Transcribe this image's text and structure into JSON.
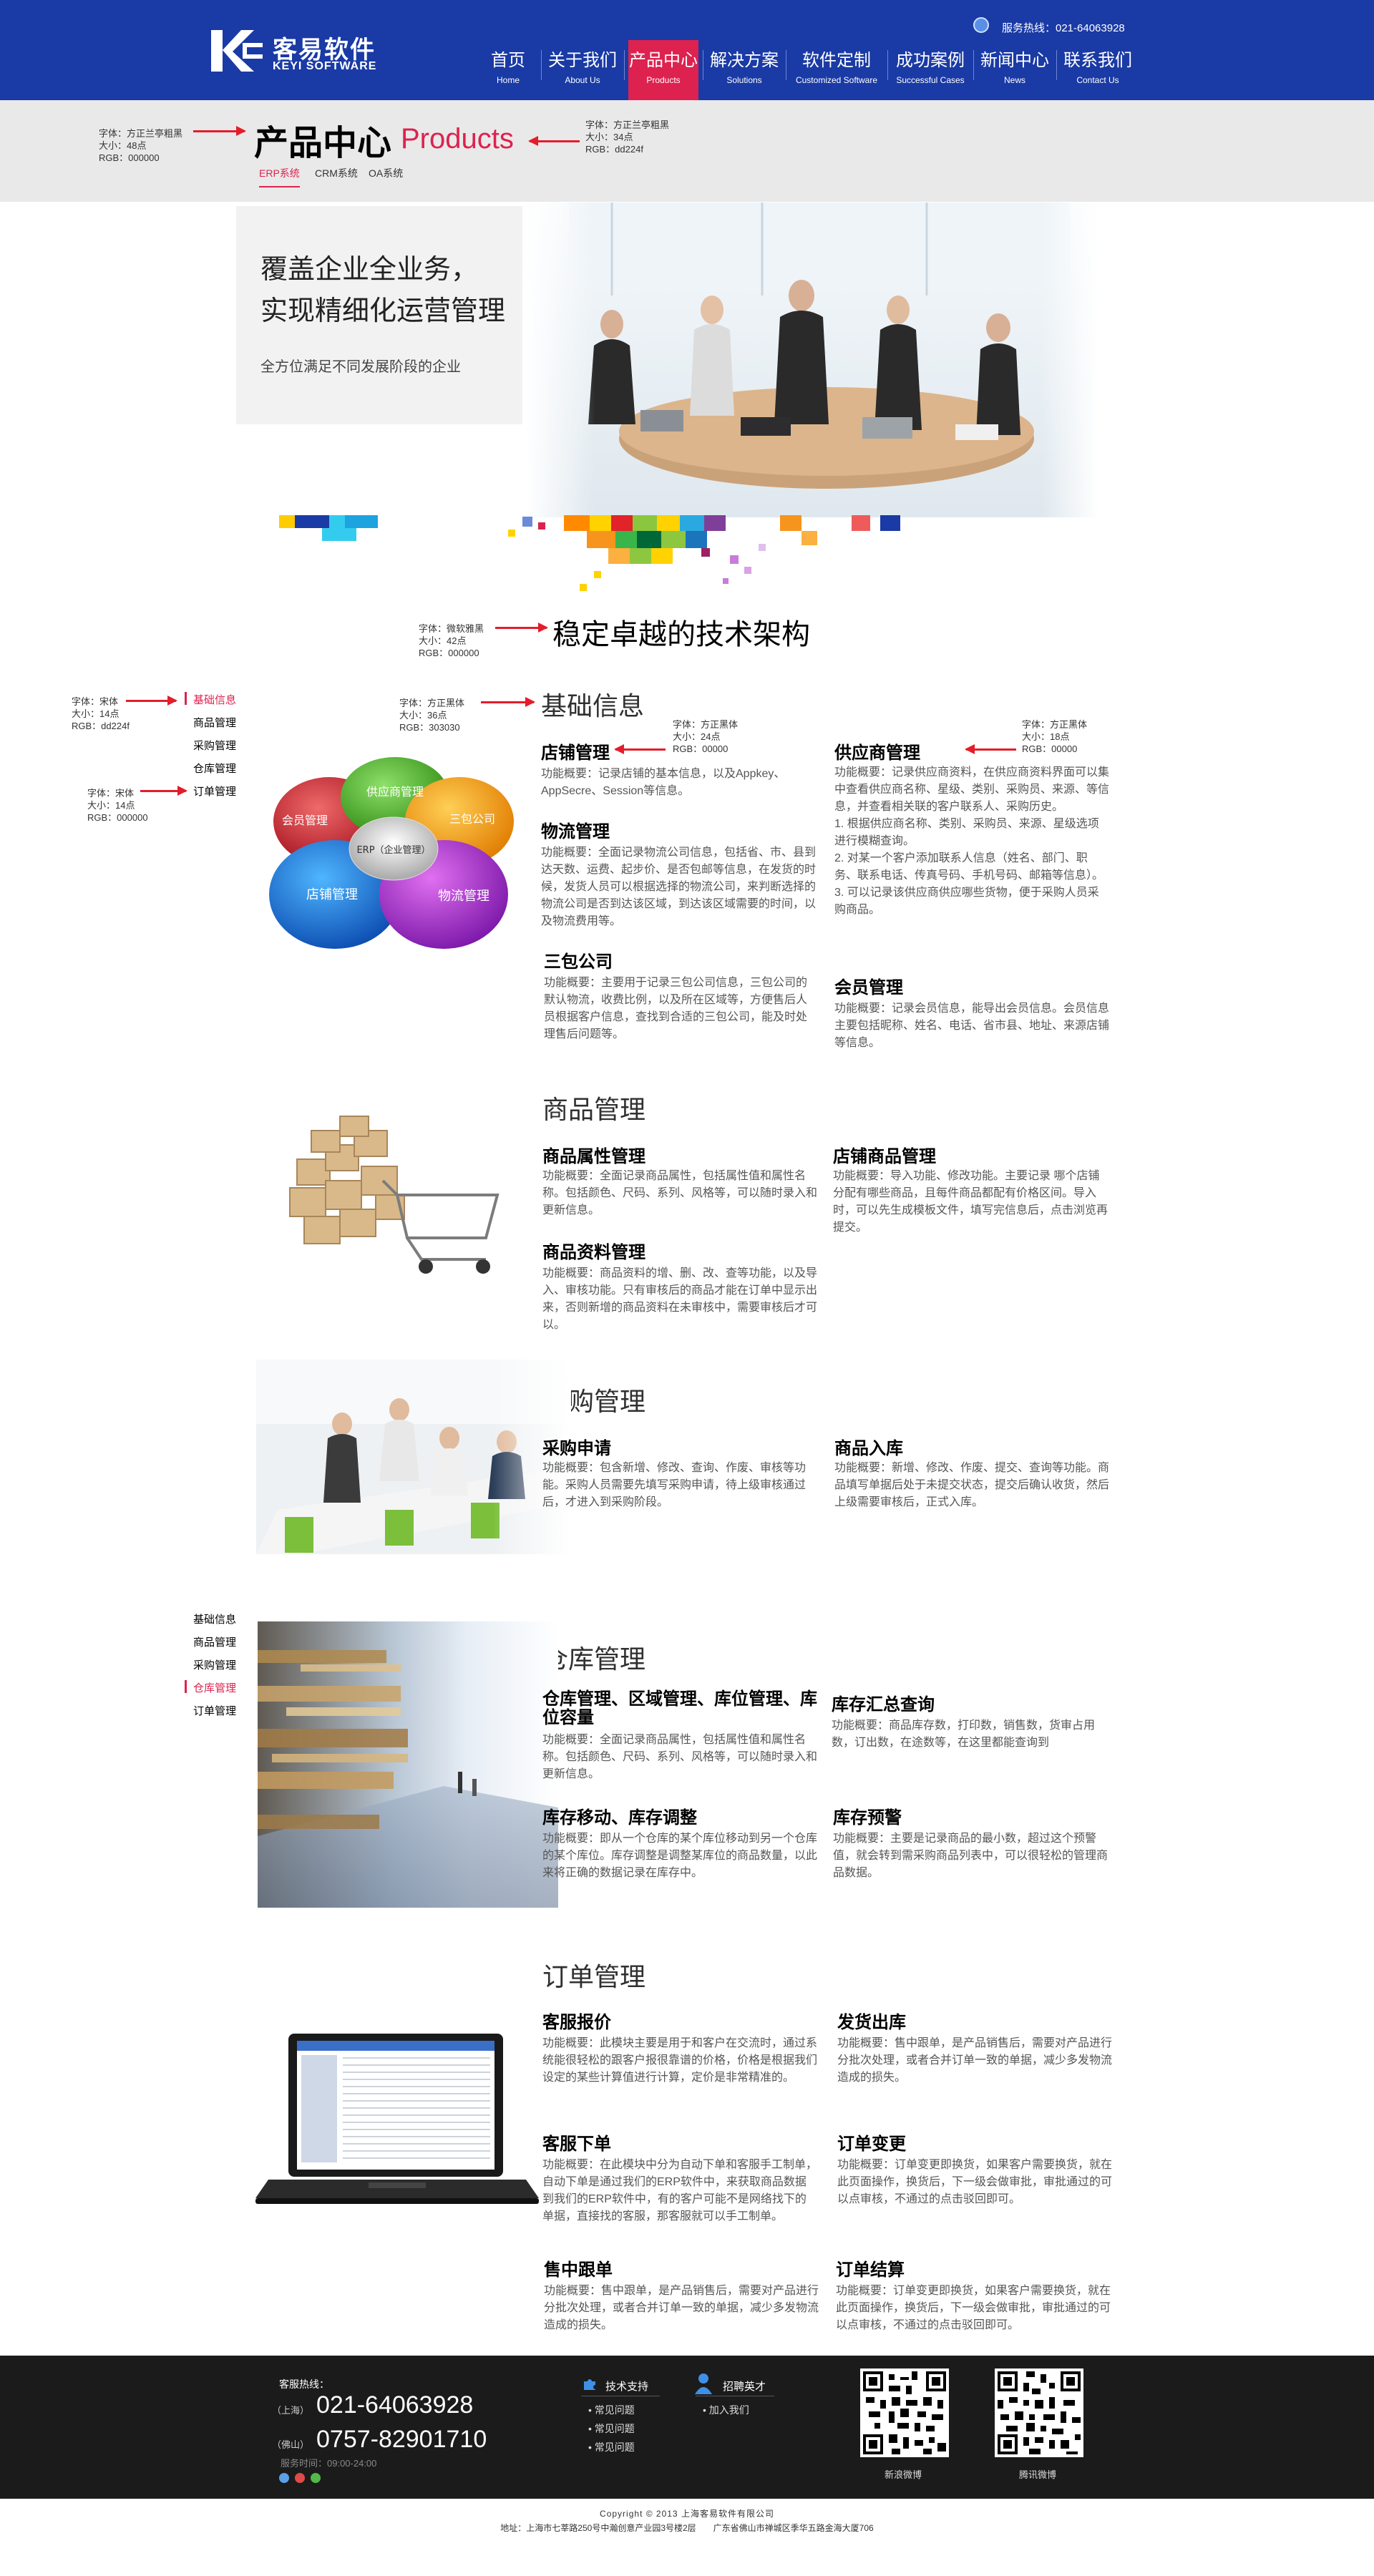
{
  "header": {
    "logo_cn": "客易软件",
    "logo_en": "KEYI SOFTWARE",
    "hotline": "服务热线：021-64063928",
    "nav": [
      {
        "zh": "首页",
        "en": "Home"
      },
      {
        "zh": "关于我们",
        "en": "About Us"
      },
      {
        "zh": "产品中心",
        "en": "Products"
      },
      {
        "zh": "解决方案",
        "en": "Solutions"
      },
      {
        "zh": "软件定制",
        "en": "Customized Software"
      },
      {
        "zh": "成功案例",
        "en": "Successful Cases"
      },
      {
        "zh": "新闻中心",
        "en": "News"
      },
      {
        "zh": "联系我们",
        "en": "Contact Us"
      }
    ]
  },
  "banner": {
    "title_cn": "产品中心",
    "title_en": "Products",
    "tabs": [
      "ERP系统",
      "CRM系统",
      "OA系统"
    ],
    "note_cn": [
      "字体：方正兰亭粗黑",
      "大小：48点",
      "RGB：000000"
    ],
    "note_en": [
      "字体：方正兰亭粗黑",
      "大小：34点",
      "RGB：dd224f"
    ]
  },
  "hero": {
    "headline_1": "覆盖企业全业务，",
    "headline_2": "实现精细化运营管理",
    "subline": "全方位满足不同发展阶段的企业"
  },
  "arch": {
    "title": "稳定卓越的技术架构",
    "note": [
      "字体：微软雅黑",
      "大小：42点",
      "RGB：000000"
    ]
  },
  "side_menu": {
    "items": [
      "基础信息",
      "商品管理",
      "采购管理",
      "仓库管理",
      "订单管理"
    ],
    "note_active": [
      "字体：宋体",
      "大小：14点",
      "RGB：dd224f"
    ],
    "note_normal": [
      "字体：宋体",
      "大小：14点",
      "RGB：000000"
    ]
  },
  "basic": {
    "title": "基础信息",
    "title_note": [
      "字体：方正黑体",
      "大小：36点",
      "RGB：303030"
    ],
    "item_note": [
      "字体：方正黑体",
      "大小：24点",
      "RGB：00000"
    ],
    "desc_note": [
      "字体：方正黑体",
      "大小：18点",
      "RGB：00000"
    ],
    "diagram": {
      "center": "ERP（企业管理）",
      "petals": [
        "供应商管理",
        "三包公司",
        "物流管理",
        "店铺管理",
        "会员管理"
      ]
    },
    "items": [
      {
        "title": "店铺管理",
        "desc": "功能概要：记录店铺的基本信息，以及Appkey、AppSecre、Session等信息。"
      },
      {
        "title": "物流管理",
        "desc": "功能概要：全面记录物流公司信息，包括省、市、县到达天数、运费、起步价、是否包邮等信息，在发货的时候，发货人员可以根据选择的物流公司，来判断选择的物流公司是否到达该区域，到达该区域需要的时间，以及物流费用等。"
      },
      {
        "title": "三包公司",
        "desc": "功能概要：主要用于记录三包公司信息，三包公司的默认物流，收费比例，以及所在区域等，方便售后人员根据客户信息，查找到合适的三包公司，能及时处理售后问题等。"
      },
      {
        "title": "供应商管理",
        "desc": "功能概要：记录供应商资料，在供应商资料界面可以集中查看供应商名称、星级、类别、采购员、来源、等信息，并查看相关联的客户联系人、采购历史。\n1. 根据供应商名称、类别、采购员、来源、星级选项进行模糊查询。\n2. 对某一个客户添加联系人信息（姓名、部门、职务、联系电话、传真号码、手机号码、邮箱等信息）。\n3. 可以记录该供应商供应哪些货物，便于采购人员采购商品。"
      },
      {
        "title": "会员管理",
        "desc": "功能概要：记录会员信息，能导出会员信息。会员信息主要包括昵称、姓名、电话、省市县、地址、来源店铺等信息。"
      }
    ]
  },
  "goods": {
    "title": "商品管理",
    "items": [
      {
        "title": "商品属性管理",
        "desc": "功能概要：全面记录商品属性，包括属性值和属性名称。包括颜色、尺码、系列、风格等，可以随时录入和更新信息。"
      },
      {
        "title": "商品资料管理",
        "desc": "功能概要：商品资料的增、删、改、查等功能，以及导入、审核功能。只有审核后的商品才能在订单中显示出来，否则新增的商品资料在未审核中，需要审核后才可以。"
      },
      {
        "title": "店铺商品管理",
        "desc": "功能概要：导入功能、修改功能。主要记录 哪个店铺分配有哪些商品，且每件商品都配有价格区间。导入时，可以先生成模板文件，填写完信息后，点击浏览再提交。"
      }
    ]
  },
  "purchase": {
    "title": "采购管理",
    "items": [
      {
        "title": "采购申请",
        "desc": "功能概要：包含新增、修改、查询、作废、审核等功能。采购人员需要先填写采购申请，待上级审核通过后，才进入到采购阶段。"
      },
      {
        "title": "商品入库",
        "desc": "功能概要：新增、修改、作废、提交、查询等功能。商品填写单据后处于未提交状态，提交后确认收货，然后上级需要审核后，正式入库。"
      }
    ]
  },
  "warehouse": {
    "title": "仓库管理",
    "items": [
      {
        "title": "仓库管理、区域管理、库位管理、库位容量",
        "desc": "功能概要：全面记录商品属性，包括属性值和属性名称。包括颜色、尺码、系列、风格等，可以随时录入和更新信息。"
      },
      {
        "title": "库存移动、库存调整",
        "desc": "功能概要：即从一个仓库的某个库位移动到另一个仓库的某个库位。库存调整是调整某库位的商品数量，以此来将正确的数据记录在库存中。"
      },
      {
        "title": "库存汇总查询",
        "desc": "功能概要：商品库存数，打印数，销售数，货审占用数，订出数，在途数等，在这里都能查询到"
      },
      {
        "title": "库存预警",
        "desc": "功能概要：主要是记录商品的最小数，超过这个预警值，就会转到需采购商品列表中，可以很轻松的管理商品数据。"
      }
    ]
  },
  "orders": {
    "title": "订单管理",
    "items": [
      {
        "title": "客服报价",
        "desc": "功能概要：此模块主要是用于和客户在交流时，通过系统能很轻松的跟客户报很靠谱的价格，价格是根据我们设定的某些计算值进行计算，定价是非常精准的。"
      },
      {
        "title": "客服下单",
        "desc": "功能概要：在此模块中分为自动下单和客服手工制单，自动下单是通过我们的ERP软件中，来获取商品数据到我们的ERP软件中，有的客户可能不是网络找下的单据，直接找的客服，那客服就可以手工制单。"
      },
      {
        "title": "售中跟单",
        "desc": "功能概要：售中跟单，是产品销售后，需要对产品进行分批次处理，或者合并订单一致的单据，减少多发物流造成的损失。"
      },
      {
        "title": "发货出库",
        "desc": "功能概要：售中跟单，是产品销售后，需要对产品进行分批次处理，或者合并订单一致的单据，减少多发物流造成的损失。"
      },
      {
        "title": "订单变更",
        "desc": "功能概要：订单变更即换货，如果客户需要换货，就在此页面操作，换货后，下一级会做审批，审批通过的可以点审核，不通过的点击驳回即可。"
      },
      {
        "title": "订单结算",
        "desc": "功能概要：订单变更即换货，如果客户需要换货，就在此页面操作，换货后，下一级会做审批，审批通过的可以点审核，不通过的点击驳回即可。"
      }
    ]
  },
  "footer": {
    "hotline_label": "客服热线：",
    "shanghai_tag": "（上海）",
    "shanghai_phone": "021-64063928",
    "foshan_tag": "（佛山）",
    "foshan_phone": "0757-82901710",
    "hours": "服务时间：09:00-24:00",
    "support_title": "技术支持",
    "support_links": [
      "常见问题",
      "常见问题",
      "常见问题"
    ],
    "jobs_title": "招聘英才",
    "jobs_links": [
      "加入我们"
    ],
    "qr1_label": "新浪微博",
    "qr2_label": "腾讯微博",
    "copyright": "Copyright © 2013 上海客易软件有限公司",
    "address": "地址：上海市七莘路250号中瀚创意产业园3号楼2层　　广东省佛山市禅城区季华五路金海大厦706"
  },
  "colors": {
    "brand_blue": "#1a3aa5",
    "accent": "#dd224f",
    "footer_bg": "#1b1b1b"
  }
}
